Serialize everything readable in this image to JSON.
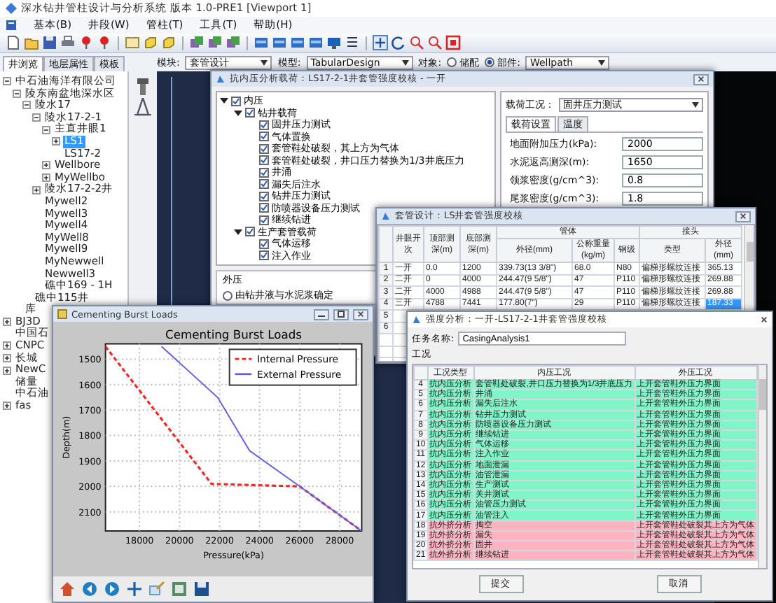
{
  "window": {
    "title": "深水钻井管柱设计与分析系统 版本 1.0-PRE1 [Viewport 1]"
  },
  "menu": [
    "基本(B)",
    "井段(W)",
    "管柱(T)",
    "工具(T)",
    "帮助(H)"
  ],
  "panel_tabs": [
    {
      "label": "井浏览",
      "selected": true
    },
    {
      "label": "地层属性",
      "selected": false
    },
    {
      "label": "模板",
      "selected": false
    }
  ],
  "selectors": {
    "module_label": "模块:",
    "module": "套管设计",
    "model_label": "模型:",
    "model": "TabularDesign",
    "object_label": "对象:",
    "object_options": [
      {
        "label": "储配",
        "selected": false
      },
      {
        "label": "部件:",
        "selected": true
      }
    ],
    "object": "Wellpath"
  },
  "tree": [
    {
      "label": "中石油海洋有限公司",
      "expanded": true,
      "selected": false,
      "children": [
        {
          "label": "陵东南盆地深水区",
          "expanded": true,
          "selected": false,
          "children": [
            {
              "label": "陵水17",
              "expanded": true,
              "selected": false,
              "children": [
                {
                  "label": "陵水17-2-1",
                  "expanded": true,
                  "selected": false,
                  "children": [
                    {
                      "label": "主直井眼1",
                      "expanded": true,
                      "selected": false,
                      "children": [
                        {
                          "label": "LS1",
                          "expanded": false,
                          "selected": true
                        },
                        {
                          "label": "LS17-2",
                          "selected": false
                        }
                      ]
                    },
                    {
                      "label": "Wellbore",
                      "expanded": false,
                      "selected": false
                    },
                    {
                      "label": "MyWellbo",
                      "expanded": false,
                      "selected": false
                    }
                  ]
                },
                {
                  "label": "陵水17-2-2井",
                  "expanded": false,
                  "selected": false
                },
                {
                  "label": "Mywell2",
                  "selected": false
                },
                {
                  "label": "Mywell3",
                  "selected": false
                },
                {
                  "label": "Mywell4",
                  "selected": false
                },
                {
                  "label": "MyWell8",
                  "selected": false
                },
                {
                  "label": "Mywell9",
                  "selected": false
                },
                {
                  "label": "MyNewwell",
                  "selected": false
                },
                {
                  "label": "Newwell3",
                  "selected": false
                },
                {
                  "label": "礁中169 - 1H",
                  "selected": false
                }
              ]
            },
            {
              "label": "礁中115井",
              "selected": false
            }
          ]
        },
        {
          "label": "库",
          "selected": false
        }
      ]
    },
    {
      "label": "BJ3D",
      "expanded": false,
      "selected": false
    },
    {
      "label": "中国石",
      "selected": false
    },
    {
      "label": "CNPC",
      "expanded": false,
      "selected": false
    },
    {
      "label": "长城",
      "expanded": false,
      "selected": false
    },
    {
      "label": "NewC",
      "expanded": false,
      "selected": false
    },
    {
      "label": "储量",
      "selected": false
    },
    {
      "label": "中石油",
      "selected": false
    },
    {
      "label": "fas",
      "expanded": false,
      "selected": false
    }
  ],
  "load_dialog": {
    "title": "抗内压分析载荷：LS17-2-1井套管强度校核 - 一开",
    "cases": [
      {
        "label": "内压",
        "checked": true,
        "expanded": true,
        "children": [
          {
            "label": "钻井载荷",
            "checked": true,
            "expanded": true,
            "children": [
              {
                "label": "固井压力测试",
                "checked": true
              },
              {
                "label": "气体置换",
                "checked": true
              },
              {
                "label": "套管鞋处破裂，其上方为气体",
                "checked": true
              },
              {
                "label": "套管鞋处破裂，井口压力替换为1/3井底压力",
                "checked": true
              },
              {
                "label": "井涌",
                "checked": true
              },
              {
                "label": "漏失后注水",
                "checked": true
              },
              {
                "label": "钻井压力测试",
                "checked": true
              },
              {
                "label": "防喷器设备压力测试",
                "checked": true
              },
              {
                "label": "继续钻进",
                "checked": true
              }
            ]
          },
          {
            "label": "生产套管载荷",
            "checked": true,
            "expanded": true,
            "children": [
              {
                "label": "气体运移",
                "checked": true
              },
              {
                "label": "注入作业",
                "checked": true
              }
            ]
          }
        ]
      }
    ],
    "external": {
      "title": "外压",
      "options": [
        {
          "label": "由钻井液与水泥浆确定",
          "selected": false
        }
      ]
    },
    "case_label": "载荷工况：",
    "case": "固井压力测试",
    "tabs": [
      {
        "label": "载荷设置",
        "selected": true
      },
      {
        "label": "温度",
        "selected": false
      }
    ],
    "fields": [
      {
        "label": "地面附加压力(kPa):",
        "value": "2000"
      },
      {
        "label": "水泥返高测深(m):",
        "value": "1650"
      },
      {
        "label": "领浆密度(g/cm^3):",
        "value": "0.8"
      },
      {
        "label": "尾浆密度(g/cm^3):",
        "value": "1.8"
      }
    ]
  },
  "casing_dialog": {
    "title": "套管设计：LS井套管强度校核",
    "columns": [
      {
        "label": "井眼开次"
      },
      {
        "label": "顶部测深(m)"
      },
      {
        "label": "底部测深(m)"
      },
      {
        "group": "管体",
        "columns": [
          "外径(mm)",
          "公称重量(kg/m)",
          "钢级"
        ]
      },
      {
        "group": "接头",
        "columns": [
          "类型",
          "外径(mm)"
        ]
      }
    ],
    "rows": [
      {
        "number": "1",
        "cells": [
          {
            "text": "一开",
            "selected": false
          },
          {
            "text": "0.0",
            "selected": false
          },
          {
            "text": "1200",
            "selected": false
          },
          {
            "text": "339.73(13 3/8\")",
            "selected": false
          },
          {
            "text": "68.0",
            "selected": false
          },
          {
            "text": "N80",
            "selected": false
          },
          {
            "text": "偏梯形螺纹连接",
            "selected": false
          },
          {
            "text": "365.13",
            "selected": false
          }
        ]
      },
      {
        "number": "2",
        "cells": [
          {
            "text": "二开",
            "selected": false
          },
          {
            "text": "0",
            "selected": false
          },
          {
            "text": "4000",
            "selected": false
          },
          {
            "text": "244.47(9 5/8\")",
            "selected": false
          },
          {
            "text": "47",
            "selected": false
          },
          {
            "text": "P110",
            "selected": false
          },
          {
            "text": "偏梯形螺纹连接",
            "selected": false
          },
          {
            "text": "269.88",
            "selected": false
          }
        ]
      },
      {
        "number": "3",
        "cells": [
          {
            "text": "二开",
            "selected": false
          },
          {
            "text": "4000",
            "selected": false
          },
          {
            "text": "4988",
            "selected": false
          },
          {
            "text": "244.47(9 5/8\")",
            "selected": false
          },
          {
            "text": "47",
            "selected": false
          },
          {
            "text": "P110",
            "selected": false
          },
          {
            "text": "偏梯形螺纹连接",
            "selected": false
          },
          {
            "text": "269.88",
            "selected": false
          }
        ]
      },
      {
        "number": "4",
        "cells": [
          {
            "text": "三开",
            "selected": false
          },
          {
            "text": "4788",
            "selected": false
          },
          {
            "text": "7441",
            "selected": false
          },
          {
            "text": "177.80(7\")",
            "selected": false
          },
          {
            "text": "29",
            "selected": false
          },
          {
            "text": "P110",
            "selected": false
          },
          {
            "text": "偏梯形螺纹连接",
            "selected": false
          },
          {
            "text": "187.33",
            "selected": true
          }
        ]
      },
      {
        "number": "5"
      },
      {
        "number": "6"
      }
    ]
  },
  "chart_window": {
    "title": "Cementing Burst Loads",
    "chart_data": {
      "type": "line",
      "title": "Cementing Burst Loads",
      "xlabel": "Pressure(kPa)",
      "ylabel": "Depth(m)",
      "grid": true,
      "legend": true,
      "series": [
        {
          "name": "Internal Pressure",
          "color": "#ff2020",
          "line_style": "dashed",
          "x": [
            16300,
            21600,
            26000,
            29100
          ],
          "values": [
            1450,
            1990,
            2000,
            2175
          ]
        },
        {
          "name": "External Pressure",
          "color": "#6060e0",
          "line_style": "solid",
          "x": [
            19100,
            21900,
            23500,
            26000,
            29100
          ],
          "values": [
            1450,
            1650,
            1860,
            2000,
            2175
          ]
        }
      ],
      "xlim": [
        16300,
        29100
      ],
      "ylim": [
        2175,
        1440
      ],
      "xticks": [
        18000,
        20000,
        22000,
        24000,
        26000,
        28000
      ],
      "yticks": [
        1500,
        1600,
        1700,
        1800,
        1900,
        2000,
        2100
      ]
    }
  },
  "analysis_dialog": {
    "title": "强度分析：一开-LS17-2-1井套管强度校核",
    "task_label": "任务名称:",
    "task": "CasingAnalysis1",
    "section": "工况",
    "columns": [
      "工况类型",
      "内压工况",
      "外压工况"
    ],
    "rows": [
      {
        "number": "4",
        "type": "抗内压分析",
        "internal": "套管鞋处破裂,井口压力替换为1/3井底压力",
        "external": "上开套管鞋外压力界面",
        "color": "#80f5c8"
      },
      {
        "number": "5",
        "type": "抗内压分析",
        "internal": "井涌",
        "external": "上开套管鞋外压力界面",
        "color": "#80f5c8"
      },
      {
        "number": "6",
        "type": "抗内压分析",
        "internal": "漏失后注水",
        "external": "上开套管鞋外压力界面",
        "color": "#80f5c8"
      },
      {
        "number": "7",
        "type": "抗内压分析",
        "internal": "钻井压力测试",
        "external": "上开套管鞋外压力界面",
        "color": "#80f5c8"
      },
      {
        "number": "8",
        "type": "抗内压分析",
        "internal": "防喷器设备压力测试",
        "external": "上开套管鞋外压力界面",
        "color": "#80f5c8"
      },
      {
        "number": "9",
        "type": "抗内压分析",
        "internal": "继续钻进",
        "external": "上开套管鞋外压力界面",
        "color": "#80f5c8"
      },
      {
        "number": "10",
        "type": "抗内压分析",
        "internal": "气体运移",
        "external": "上开套管鞋外压力界面",
        "color": "#80f5c8"
      },
      {
        "number": "11",
        "type": "抗内压分析",
        "internal": "注入作业",
        "external": "上开套管鞋外压力界面",
        "color": "#80f5c8"
      },
      {
        "number": "12",
        "type": "抗内压分析",
        "internal": "地面泄漏",
        "external": "上开套管鞋外压力界面",
        "color": "#80f5c8"
      },
      {
        "number": "13",
        "type": "抗内压分析",
        "internal": "油管泄漏",
        "external": "上开套管鞋外压力界面",
        "color": "#80f5c8"
      },
      {
        "number": "14",
        "type": "抗内压分析",
        "internal": "生产测试",
        "external": "上开套管鞋外压力界面",
        "color": "#80f5c8"
      },
      {
        "number": "15",
        "type": "抗内压分析",
        "internal": "关井测试",
        "external": "上开套管鞋外压力界面",
        "color": "#80f5c8"
      },
      {
        "number": "16",
        "type": "抗内压分析",
        "internal": "油管压力测试",
        "external": "上开套管鞋外压力界面",
        "color": "#80f5c8"
      },
      {
        "number": "17",
        "type": "抗内压分析",
        "internal": "油管注入",
        "external": "上开套管鞋外压力界面",
        "color": "#80f5c8"
      },
      {
        "number": "18",
        "type": "抗外挤分析",
        "internal": "掏空",
        "external": "上开套管鞋处破裂其上方为气体",
        "color": "#ffb3c0"
      },
      {
        "number": "19",
        "type": "抗外挤分析",
        "internal": "漏失",
        "external": "上开套管鞋处破裂其上方为气体",
        "color": "#ffb3c0"
      },
      {
        "number": "20",
        "type": "抗外挤分析",
        "internal": "固井",
        "external": "上开套管鞋处破裂其上方为气体",
        "color": "#ffb3c0"
      },
      {
        "number": "21",
        "type": "抗外挤分析",
        "internal": "继续钻进",
        "external": "上开套管鞋处破裂其上方为气体",
        "color": "#ffb3c0"
      }
    ],
    "buttons": [
      "提交",
      "取消"
    ]
  }
}
